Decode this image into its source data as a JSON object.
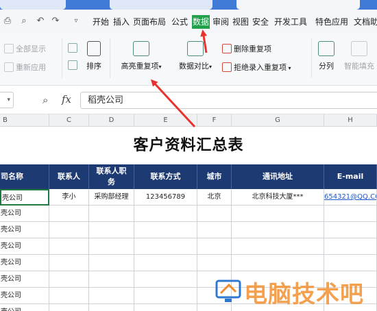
{
  "menubar": {
    "items": [
      "开始",
      "插入",
      "页面布局",
      "公式",
      "数据",
      "审阅",
      "视图",
      "安全",
      "开发工具",
      "特色应用",
      "文档助"
    ],
    "active": "数据"
  },
  "ribbon": {
    "show_all": "全部显示",
    "reapply": "重新应用",
    "sort": "排序",
    "highlight_duplicates": "高亮重复项",
    "data_compare": "数据对比",
    "delete_duplicates": "删除重复项",
    "reject_duplicate_entry": "拒绝录入重复项",
    "split_column": "分列",
    "smart_fill": "智能填充"
  },
  "formula_bar": {
    "fx_label": "fx",
    "value": "稻壳公司"
  },
  "columns": [
    "B",
    "C",
    "D",
    "E",
    "F",
    "G",
    "H"
  ],
  "sheet": {
    "title": "客户资料汇总表",
    "headers": [
      "司名称",
      "联系人",
      "联系人职务",
      "联系方式",
      "城市",
      "通讯地址",
      "E-mail"
    ],
    "rows": [
      [
        "壳公司",
        "李小",
        "采购部经理",
        "123456789",
        "北京",
        "北京科技大厦***",
        "654321@QQ.CO"
      ],
      [
        "壳公司",
        "",
        "",
        "",
        "",
        "",
        ""
      ],
      [
        "壳公司",
        "",
        "",
        "",
        "",
        "",
        ""
      ],
      [
        "壳公司",
        "",
        "",
        "",
        "",
        "",
        ""
      ],
      [
        "壳公司",
        "",
        "",
        "",
        "",
        "",
        ""
      ],
      [
        "壳公司",
        "",
        "",
        "",
        "",
        "",
        ""
      ],
      [
        "壳公司",
        "",
        "",
        "",
        "",
        "",
        ""
      ],
      [
        "壳公司",
        "",
        "",
        "",
        "",
        "",
        ""
      ]
    ]
  },
  "watermark": {
    "text": "电脑技术吧"
  },
  "colors": {
    "accent_green": "#22a04b",
    "header_navy": "#1e3a73",
    "title_blue": "#3f7ad6",
    "arrow_red": "#e8322e"
  }
}
